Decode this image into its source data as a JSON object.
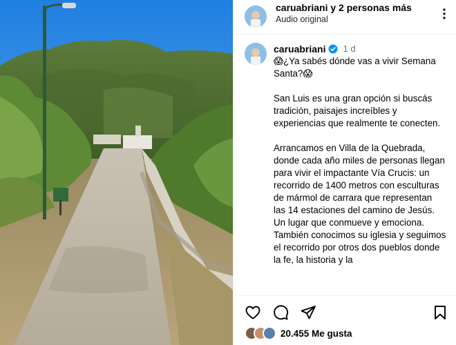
{
  "header": {
    "names_user": "caruabriani",
    "names_rest": "y 2 personas más",
    "audio": "Audio original",
    "more_icon": "more-horizontal-icon"
  },
  "post": {
    "username": "caruabriani",
    "time": "1 d",
    "verified_color": "#0095f6",
    "caption": {
      "p1": "😱¿Ya sabés dónde vas a vivir Semana Santa?😱",
      "p2": "San Luis es una gran opción si buscás tradición, paisajes increíbles y experiencias que realmente te conecten.",
      "p3": "Arrancamos en Villa de la Quebrada, donde cada año miles de personas llegan para vivir el impactante Vía Crucis: un recorrido de 1400 metros con esculturas de mármol de carrara que representan las 14 estaciones del camino de Jesús. Un lugar que conmueve y emociona.",
      "p4": "También conocimos su iglesia y seguimos el recorrido por otros dos pueblos donde la fe, la historia y la"
    }
  },
  "actions": {
    "like_icon": "heart-icon",
    "comment_icon": "comment-icon",
    "share_icon": "send-icon",
    "save_icon": "bookmark-icon"
  },
  "likes": {
    "count": "20.455 Me gusta"
  }
}
